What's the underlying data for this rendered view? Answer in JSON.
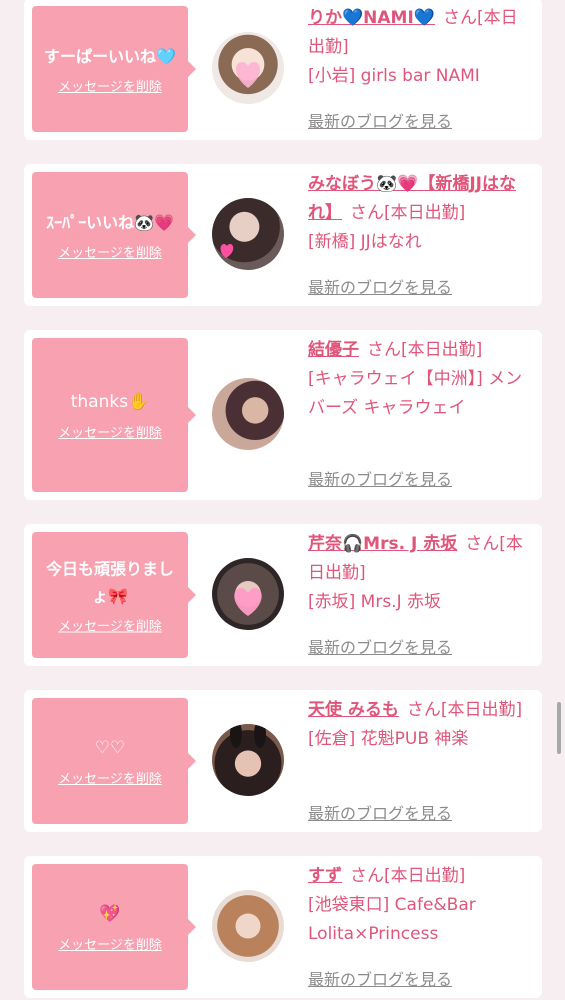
{
  "common": {
    "delete_label": "メッセージを削除",
    "blog_label": "最新のブログを見る"
  },
  "items": [
    {
      "message": "すーぱーいいね🩵",
      "name": "りか💙NAMI💙",
      "status": "さん[本日出勤]",
      "shop": "[小岩] girls bar NAMI",
      "avatar_icon": "girl-photo-heart-sticker"
    },
    {
      "message": "ｽｰﾊﾟｰいいね🐼💗",
      "name": "みなぼう🐼💗【新橋JJはなれ】",
      "status": "さん[本日出勤]",
      "shop": "[新橋] JJはなれ",
      "avatar_icon": "girl-photo-dark-hair"
    },
    {
      "message": "thanks✋",
      "name": "結優子",
      "status": "さん[本日出勤]",
      "shop": "[キャラウェイ【中洲】] メンバーズ キャラウェイ",
      "avatar_icon": "girl-photo-warm-light"
    },
    {
      "message": "今日も頑張りましょ🎀",
      "name": "芹奈🎧Mrs. J 赤坂",
      "status": "さん[本日出勤]",
      "shop": "[赤坂] Mrs.J 赤坂",
      "avatar_icon": "girl-photo-heart-mask"
    },
    {
      "message": "♡♡",
      "name": "天使 みるも",
      "status": "さん[本日出勤]",
      "shop": "[佐倉] 花魁PUB 神楽",
      "avatar_icon": "girl-photo-bunny-ears"
    },
    {
      "message": "💖",
      "name": "すず",
      "status": "さん[本日出勤]",
      "shop": "[池袋東口] Cafe&Bar Lolita×Princess",
      "avatar_icon": "girl-photo-sticker"
    }
  ],
  "colors": {
    "accent": "#e0567b",
    "bubble": "#f7a1b1",
    "background": "#f6eef1",
    "link_gray": "#8c8c8c"
  }
}
